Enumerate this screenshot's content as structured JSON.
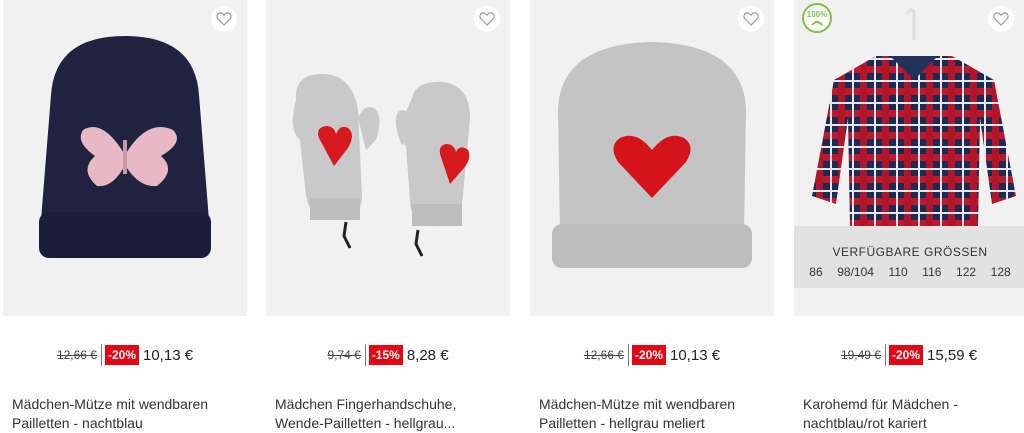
{
  "products": [
    {
      "old_price": "12,66 €",
      "discount": "-20%",
      "new_price": "10,13 €",
      "title_line1": "Mädchen-Mütze mit wendbaren",
      "title_line2": "Pailletten - nachtblau",
      "image_icon": "navy-beanie-butterfly"
    },
    {
      "old_price": "9,74 €",
      "discount": "-15%",
      "new_price": "8,28 €",
      "title_line1": "Mädchen Fingerhandschuhe,",
      "title_line2": "Wende-Pailletten - hellgrau...",
      "image_icon": "grey-mittens-hearts"
    },
    {
      "old_price": "12,66 €",
      "discount": "-20%",
      "new_price": "10,13 €",
      "title_line1": "Mädchen-Mütze mit wendbaren",
      "title_line2": "Pailletten - hellgrau meliert",
      "image_icon": "grey-beanie-heart"
    },
    {
      "old_price": "19,49 €",
      "discount": "-20%",
      "new_price": "15,59 €",
      "title_line1": "Karohemd für Mädchen -",
      "title_line2": "nachtblau/rot kariert",
      "image_icon": "plaid-shirt",
      "badge": "100%",
      "sizes_heading": "VERFÜGBARE GRÖSSEN",
      "sizes": [
        "86",
        "98/104",
        "110",
        "116",
        "122",
        "128"
      ]
    }
  ],
  "colors": {
    "discount_bg": "#e30613",
    "image_bg": "#f1f1f1",
    "text": "#333333"
  }
}
